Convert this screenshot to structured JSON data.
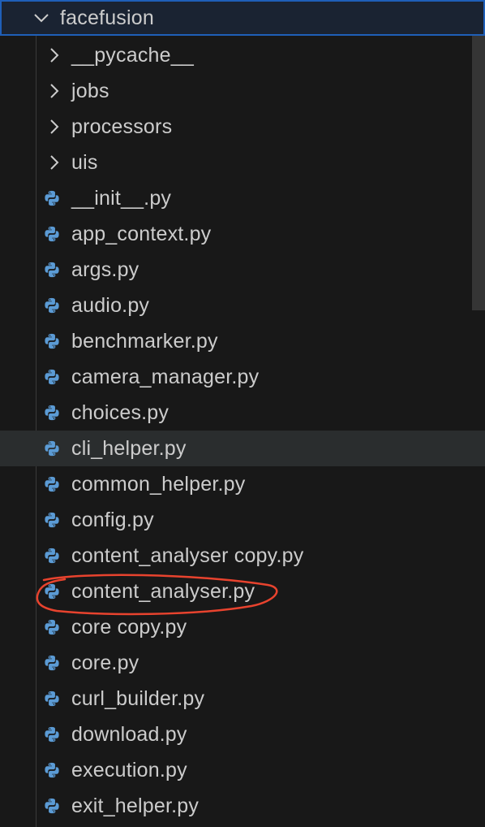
{
  "explorer": {
    "root_folder": {
      "label": "facefusion",
      "icon": "chevron-down-icon",
      "expanded": true
    },
    "folders": [
      {
        "label": "__pycache__",
        "icon": "chevron-right-icon"
      },
      {
        "label": "jobs",
        "icon": "chevron-right-icon"
      },
      {
        "label": "processors",
        "icon": "chevron-right-icon"
      },
      {
        "label": "uis",
        "icon": "chevron-right-icon"
      }
    ],
    "files": [
      {
        "label": "__init__.py",
        "icon": "python-icon"
      },
      {
        "label": "app_context.py",
        "icon": "python-icon"
      },
      {
        "label": "args.py",
        "icon": "python-icon"
      },
      {
        "label": "audio.py",
        "icon": "python-icon"
      },
      {
        "label": "benchmarker.py",
        "icon": "python-icon"
      },
      {
        "label": "camera_manager.py",
        "icon": "python-icon"
      },
      {
        "label": "choices.py",
        "icon": "python-icon"
      },
      {
        "label": "cli_helper.py",
        "icon": "python-icon",
        "hovered": true
      },
      {
        "label": "common_helper.py",
        "icon": "python-icon"
      },
      {
        "label": "config.py",
        "icon": "python-icon"
      },
      {
        "label": "content_analyser copy.py",
        "icon": "python-icon"
      },
      {
        "label": "content_analyser.py",
        "icon": "python-icon",
        "annotated": true
      },
      {
        "label": "core copy.py",
        "icon": "python-icon"
      },
      {
        "label": "core.py",
        "icon": "python-icon"
      },
      {
        "label": "curl_builder.py",
        "icon": "python-icon"
      },
      {
        "label": "download.py",
        "icon": "python-icon"
      },
      {
        "label": "execution.py",
        "icon": "python-icon"
      },
      {
        "label": "exit_helper.py",
        "icon": "python-icon"
      }
    ]
  },
  "colors": {
    "background": "#181818",
    "text": "#cccccc",
    "selection_border": "#1f5fb8",
    "hover_row": "#2a2d2e",
    "python_icon": "#5b9bd5",
    "annotation": "#e8432e"
  }
}
